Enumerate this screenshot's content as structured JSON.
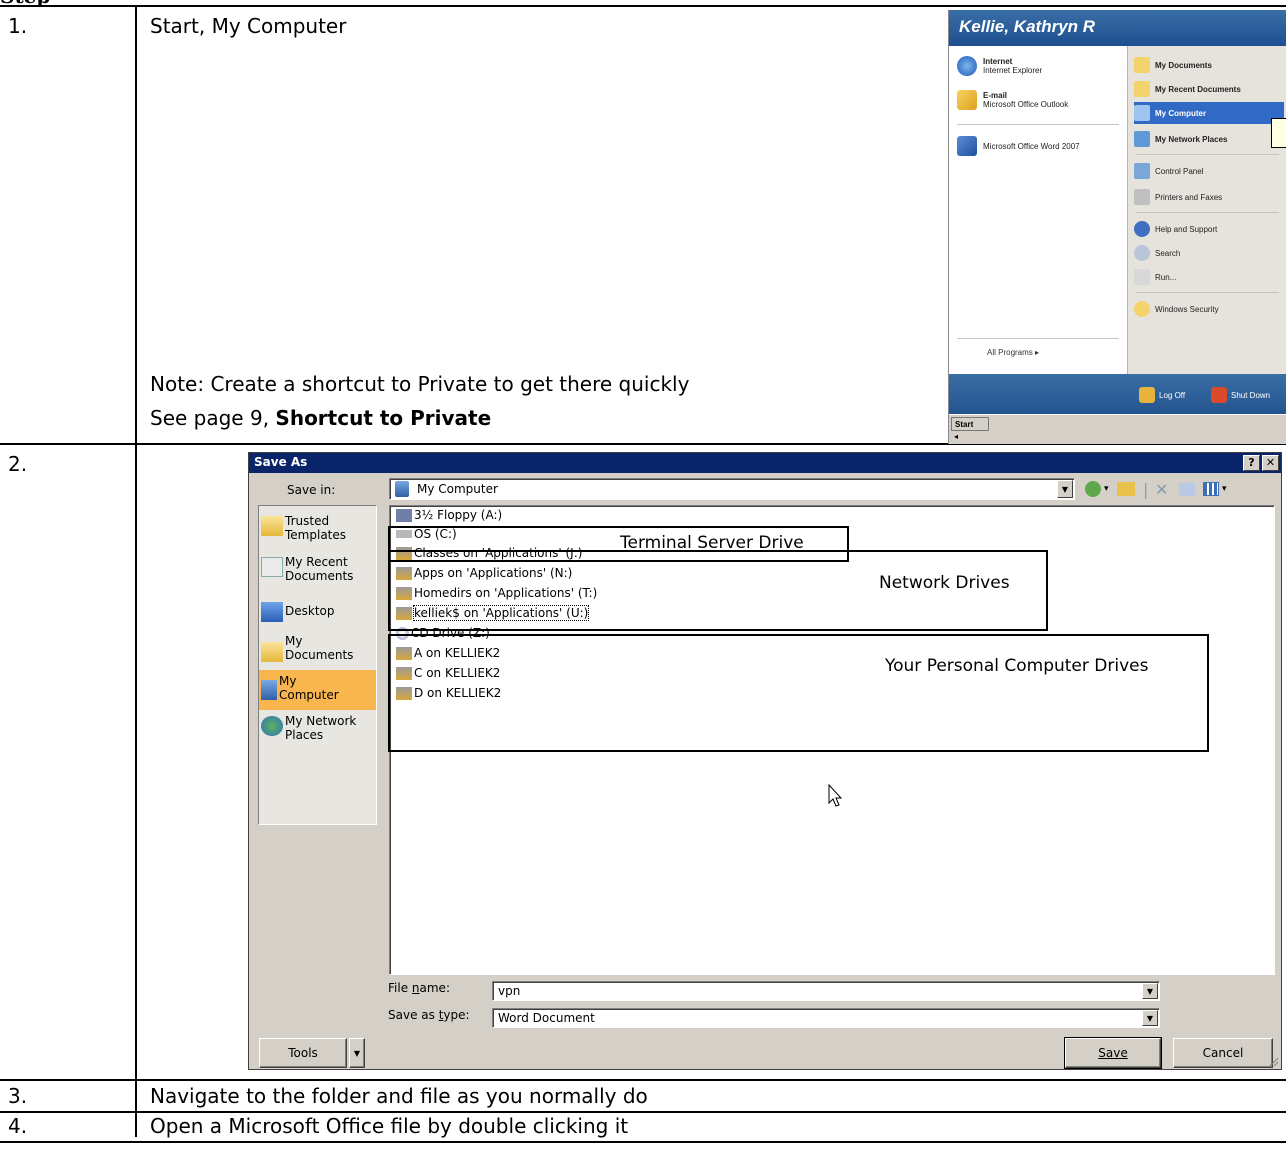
{
  "top_fragment": "Step",
  "rows": [
    {
      "num": "1.",
      "text": "Start, My Computer"
    },
    {
      "num": "2."
    },
    {
      "num": "3.",
      "text": "Navigate to the folder and file as you normally do"
    },
    {
      "num": "4.",
      "text": "Open a Microsoft Office file by double clicking it"
    }
  ],
  "note": {
    "line1": "Note: Create a shortcut to Private to get there quickly",
    "line2_prefix": "See page 9, ",
    "line2_bold": "Shortcut to Private"
  },
  "start_menu": {
    "user": "Kellie, Kathryn R",
    "left_items": [
      {
        "title": "Internet",
        "sub": "Internet Explorer",
        "icon": "ie-icon"
      },
      {
        "title": "E-mail",
        "sub": "Microsoft Office Outlook",
        "icon": "outlook-icon"
      },
      {
        "title": "Microsoft Office Word 2007",
        "sub": "",
        "icon": "word-icon"
      }
    ],
    "right_items": [
      "My Documents",
      "My Recent Documents",
      "My Computer",
      "My Network Places",
      "Control Panel",
      "Printers and Faxes",
      "Help and Support",
      "Search",
      "Run...",
      "Windows Security"
    ],
    "all_programs": "All Programs",
    "log_off": "Log Off",
    "shut_down": "Shut Down",
    "start": "Start"
  },
  "dialog": {
    "title": "Save As",
    "help_btn": "?",
    "close_btn": "✕",
    "save_in_label": "Save in:",
    "save_in_value": "My Computer",
    "places": [
      "Trusted Templates",
      "My Recent Documents",
      "Desktop",
      "My Documents",
      "My Computer",
      "My Network Places"
    ],
    "files": [
      "3½ Floppy (A:)",
      "OS (C:)",
      "Classes on 'Applications' (J:)",
      "Apps on 'Applications' (N:)",
      "Homedirs on 'Applications' (T:)",
      "kelliek$ on 'Applications' (U:)",
      "CD Drive (Z:)",
      "A on KELLIEK2",
      "C on KELLIEK2",
      "D on KELLIEK2"
    ],
    "annotations": {
      "terminal": "Terminal Server Drive",
      "network": "Network Drives",
      "personal": "Your Personal Computer Drives"
    },
    "file_name_label": "File name:",
    "file_name_value": "vpn",
    "save_type_label": "Save as type:",
    "save_type_value": "Word Document",
    "tools_label": "Tools",
    "save_label": "Save",
    "cancel_label": "Cancel"
  }
}
